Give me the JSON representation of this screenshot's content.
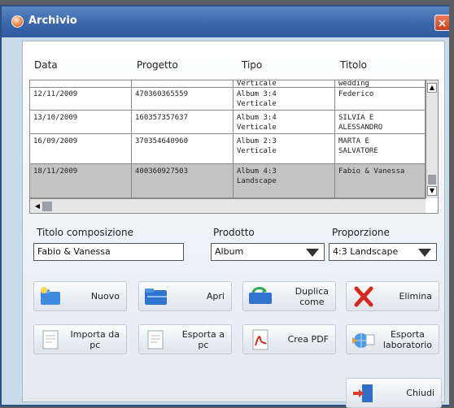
{
  "window": {
    "title": "Archivio",
    "close_label": "×"
  },
  "grid": {
    "columns": [
      "Data",
      "Progetto",
      "Tipo",
      "Titolo"
    ],
    "partial_row": {
      "tipo": "Verticale",
      "titolo": "wedding"
    },
    "rows": [
      {
        "data": "12/11/2009",
        "progetto": "470360365559",
        "tipo": "Album 3:4\nVerticale",
        "titolo": "Federico"
      },
      {
        "data": "13/10/2009",
        "progetto": "160357357637",
        "tipo": "Album 3:4\nVerticale",
        "titolo": "SILVIA E\nALESSANDRO"
      },
      {
        "data": "16/09/2009",
        "progetto": "370354640960",
        "tipo": "Album 2:3\nVerticale",
        "titolo": "MARTA E\nSALVATORE"
      },
      {
        "data": "18/11/2009",
        "progetto": "400360927503",
        "tipo": "Album 4:3\nLandscape",
        "titolo": "Fabio & Vanessa",
        "selected": true
      }
    ]
  },
  "form": {
    "titolo_label": "Titolo composizione",
    "titolo_value": "Fabio & Vanessa",
    "prodotto_label": "Prodotto",
    "prodotto_value": "Album",
    "proporzione_label": "Proporzione",
    "proporzione_value": "4:3 Landscape"
  },
  "buttons": {
    "nuovo": "Nuovo",
    "apri": "Apri",
    "duplica": "Duplica\ncome",
    "elimina": "Elimina",
    "importa": "Importa da\npc",
    "esporta_pc": "Esporta a\npc",
    "crea_pdf": "Crea PDF",
    "esporta_lab": "Esporta\nlaboratorio",
    "chiudi": "Chiudi"
  },
  "colors": {
    "titlebar": "#3a68ab",
    "selected_row": "#c4c4c4",
    "delete_red": "#d8281e"
  }
}
